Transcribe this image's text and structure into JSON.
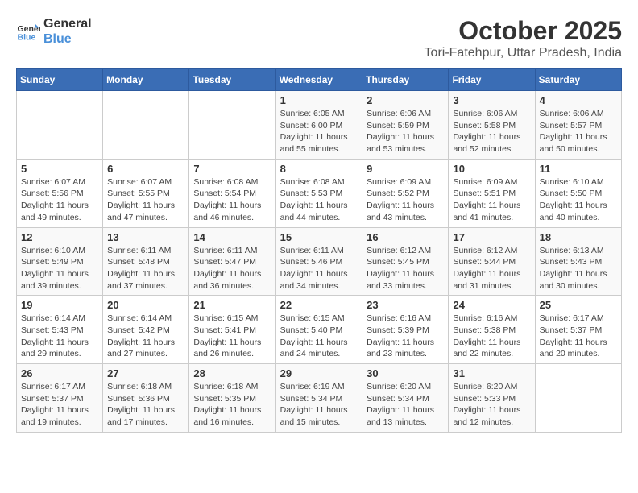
{
  "logo": {
    "line1": "General",
    "line2": "Blue"
  },
  "title": "October 2025",
  "location": "Tori-Fatehpur, Uttar Pradesh, India",
  "days_of_week": [
    "Sunday",
    "Monday",
    "Tuesday",
    "Wednesday",
    "Thursday",
    "Friday",
    "Saturday"
  ],
  "weeks": [
    [
      {
        "day": "",
        "info": ""
      },
      {
        "day": "",
        "info": ""
      },
      {
        "day": "",
        "info": ""
      },
      {
        "day": "1",
        "info": "Sunrise: 6:05 AM\nSunset: 6:00 PM\nDaylight: 11 hours\nand 55 minutes."
      },
      {
        "day": "2",
        "info": "Sunrise: 6:06 AM\nSunset: 5:59 PM\nDaylight: 11 hours\nand 53 minutes."
      },
      {
        "day": "3",
        "info": "Sunrise: 6:06 AM\nSunset: 5:58 PM\nDaylight: 11 hours\nand 52 minutes."
      },
      {
        "day": "4",
        "info": "Sunrise: 6:06 AM\nSunset: 5:57 PM\nDaylight: 11 hours\nand 50 minutes."
      }
    ],
    [
      {
        "day": "5",
        "info": "Sunrise: 6:07 AM\nSunset: 5:56 PM\nDaylight: 11 hours\nand 49 minutes."
      },
      {
        "day": "6",
        "info": "Sunrise: 6:07 AM\nSunset: 5:55 PM\nDaylight: 11 hours\nand 47 minutes."
      },
      {
        "day": "7",
        "info": "Sunrise: 6:08 AM\nSunset: 5:54 PM\nDaylight: 11 hours\nand 46 minutes."
      },
      {
        "day": "8",
        "info": "Sunrise: 6:08 AM\nSunset: 5:53 PM\nDaylight: 11 hours\nand 44 minutes."
      },
      {
        "day": "9",
        "info": "Sunrise: 6:09 AM\nSunset: 5:52 PM\nDaylight: 11 hours\nand 43 minutes."
      },
      {
        "day": "10",
        "info": "Sunrise: 6:09 AM\nSunset: 5:51 PM\nDaylight: 11 hours\nand 41 minutes."
      },
      {
        "day": "11",
        "info": "Sunrise: 6:10 AM\nSunset: 5:50 PM\nDaylight: 11 hours\nand 40 minutes."
      }
    ],
    [
      {
        "day": "12",
        "info": "Sunrise: 6:10 AM\nSunset: 5:49 PM\nDaylight: 11 hours\nand 39 minutes."
      },
      {
        "day": "13",
        "info": "Sunrise: 6:11 AM\nSunset: 5:48 PM\nDaylight: 11 hours\nand 37 minutes."
      },
      {
        "day": "14",
        "info": "Sunrise: 6:11 AM\nSunset: 5:47 PM\nDaylight: 11 hours\nand 36 minutes."
      },
      {
        "day": "15",
        "info": "Sunrise: 6:11 AM\nSunset: 5:46 PM\nDaylight: 11 hours\nand 34 minutes."
      },
      {
        "day": "16",
        "info": "Sunrise: 6:12 AM\nSunset: 5:45 PM\nDaylight: 11 hours\nand 33 minutes."
      },
      {
        "day": "17",
        "info": "Sunrise: 6:12 AM\nSunset: 5:44 PM\nDaylight: 11 hours\nand 31 minutes."
      },
      {
        "day": "18",
        "info": "Sunrise: 6:13 AM\nSunset: 5:43 PM\nDaylight: 11 hours\nand 30 minutes."
      }
    ],
    [
      {
        "day": "19",
        "info": "Sunrise: 6:14 AM\nSunset: 5:43 PM\nDaylight: 11 hours\nand 29 minutes."
      },
      {
        "day": "20",
        "info": "Sunrise: 6:14 AM\nSunset: 5:42 PM\nDaylight: 11 hours\nand 27 minutes."
      },
      {
        "day": "21",
        "info": "Sunrise: 6:15 AM\nSunset: 5:41 PM\nDaylight: 11 hours\nand 26 minutes."
      },
      {
        "day": "22",
        "info": "Sunrise: 6:15 AM\nSunset: 5:40 PM\nDaylight: 11 hours\nand 24 minutes."
      },
      {
        "day": "23",
        "info": "Sunrise: 6:16 AM\nSunset: 5:39 PM\nDaylight: 11 hours\nand 23 minutes."
      },
      {
        "day": "24",
        "info": "Sunrise: 6:16 AM\nSunset: 5:38 PM\nDaylight: 11 hours\nand 22 minutes."
      },
      {
        "day": "25",
        "info": "Sunrise: 6:17 AM\nSunset: 5:37 PM\nDaylight: 11 hours\nand 20 minutes."
      }
    ],
    [
      {
        "day": "26",
        "info": "Sunrise: 6:17 AM\nSunset: 5:37 PM\nDaylight: 11 hours\nand 19 minutes."
      },
      {
        "day": "27",
        "info": "Sunrise: 6:18 AM\nSunset: 5:36 PM\nDaylight: 11 hours\nand 17 minutes."
      },
      {
        "day": "28",
        "info": "Sunrise: 6:18 AM\nSunset: 5:35 PM\nDaylight: 11 hours\nand 16 minutes."
      },
      {
        "day": "29",
        "info": "Sunrise: 6:19 AM\nSunset: 5:34 PM\nDaylight: 11 hours\nand 15 minutes."
      },
      {
        "day": "30",
        "info": "Sunrise: 6:20 AM\nSunset: 5:34 PM\nDaylight: 11 hours\nand 13 minutes."
      },
      {
        "day": "31",
        "info": "Sunrise: 6:20 AM\nSunset: 5:33 PM\nDaylight: 11 hours\nand 12 minutes."
      },
      {
        "day": "",
        "info": ""
      }
    ]
  ]
}
